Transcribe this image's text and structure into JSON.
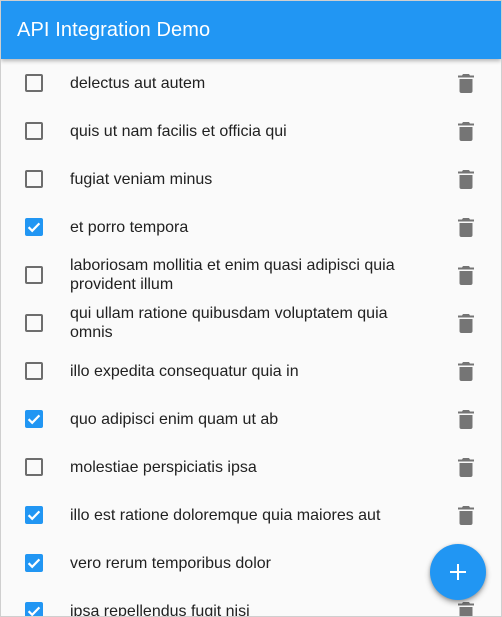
{
  "app_bar": {
    "title": "API Integration Demo",
    "color": "#2196f3"
  },
  "todos": [
    {
      "title": "delectus aut autem",
      "completed": false
    },
    {
      "title": "quis ut nam facilis et officia qui",
      "completed": false
    },
    {
      "title": "fugiat veniam minus",
      "completed": false
    },
    {
      "title": "et porro tempora",
      "completed": true
    },
    {
      "title": "laboriosam mollitia et enim quasi adipisci quia provident illum",
      "completed": false
    },
    {
      "title": "qui ullam ratione quibusdam voluptatem quia omnis",
      "completed": false
    },
    {
      "title": "illo expedita consequatur quia in",
      "completed": false
    },
    {
      "title": "quo adipisci enim quam ut ab",
      "completed": true
    },
    {
      "title": "molestiae perspiciatis ipsa",
      "completed": false
    },
    {
      "title": "illo est ratione doloremque quia maiores aut",
      "completed": true
    },
    {
      "title": "vero rerum temporibus dolor",
      "completed": true
    },
    {
      "title": "ipsa repellendus fugit nisi",
      "completed": true
    }
  ],
  "row_icons": {
    "checkbox": "checkbox-icon",
    "delete": "trash-icon"
  },
  "fab": {
    "icon": "plus-icon",
    "color": "#2196f3"
  }
}
